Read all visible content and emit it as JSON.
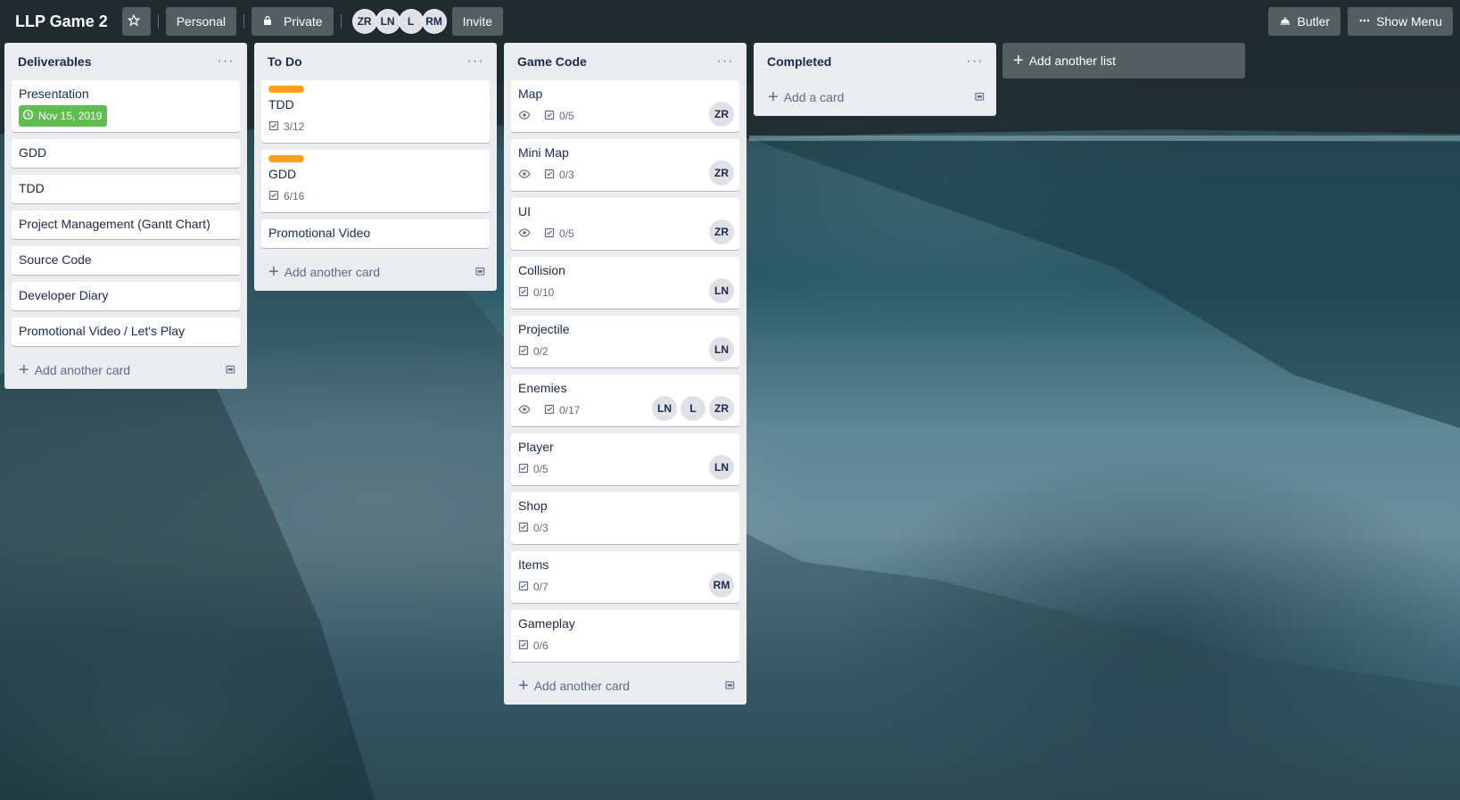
{
  "board": {
    "title": "LLP Game 2",
    "team_label": "Personal",
    "visibility_label": "Private",
    "invite_label": "Invite",
    "members": [
      "ZR",
      "LN",
      "L",
      "RM"
    ],
    "butler_label": "Butler",
    "show_menu_label": "Show Menu"
  },
  "colors": {
    "label_orange": "#ff9f1a",
    "due_green": "#61bd4f",
    "list_bg": "#ebecf0"
  },
  "lists": [
    {
      "title": "Deliverables",
      "add_label": "Add another card",
      "cards": [
        {
          "title": "Presentation",
          "due": "Nov 15, 2019"
        },
        {
          "title": "GDD"
        },
        {
          "title": "TDD"
        },
        {
          "title": "Project Management (Gantt Chart)"
        },
        {
          "title": "Source Code"
        },
        {
          "title": "Developer Diary"
        },
        {
          "title": "Promotional Video / Let's Play"
        }
      ]
    },
    {
      "title": "To Do",
      "add_label": "Add another card",
      "cards": [
        {
          "title": "TDD",
          "label": "orange",
          "checklist": "3/12"
        },
        {
          "title": "GDD",
          "label": "orange",
          "checklist": "6/16"
        },
        {
          "title": "Promotional Video"
        }
      ]
    },
    {
      "title": "Game Code",
      "add_label": "Add another card",
      "cards": [
        {
          "title": "Map",
          "watch": true,
          "checklist": "0/5",
          "members": [
            "ZR"
          ]
        },
        {
          "title": "Mini Map",
          "watch": true,
          "checklist": "0/3",
          "members": [
            "ZR"
          ]
        },
        {
          "title": "UI",
          "watch": true,
          "checklist": "0/5",
          "members": [
            "ZR"
          ]
        },
        {
          "title": "Collision",
          "checklist": "0/10",
          "members": [
            "LN"
          ]
        },
        {
          "title": "Projectile",
          "checklist": "0/2",
          "members": [
            "LN"
          ]
        },
        {
          "title": "Enemies",
          "watch": true,
          "checklist": "0/17",
          "members": [
            "LN",
            "L",
            "ZR"
          ]
        },
        {
          "title": "Player",
          "checklist": "0/5",
          "members": [
            "LN"
          ]
        },
        {
          "title": "Shop",
          "checklist": "0/3"
        },
        {
          "title": "Items",
          "checklist": "0/7",
          "members": [
            "RM"
          ]
        },
        {
          "title": "Gameplay",
          "checklist": "0/6"
        }
      ]
    },
    {
      "title": "Completed",
      "add_label": "Add a card",
      "cards": []
    }
  ],
  "add_list_label": "Add another list"
}
